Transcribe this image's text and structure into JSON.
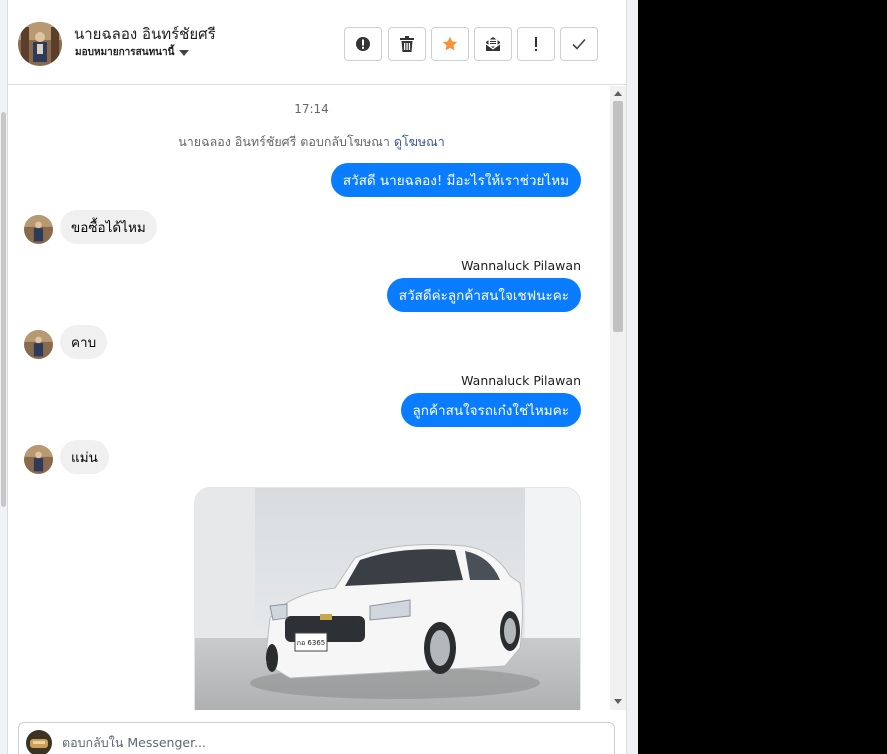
{
  "header": {
    "contact_name": "นายฉลอง อินทร์ชัยศรี",
    "assign_label": "มอบหมายการสนทนานี้",
    "buttons": [
      {
        "name": "report-button",
        "icon": "exclamation-circle-icon"
      },
      {
        "name": "delete-button",
        "icon": "trash-icon"
      },
      {
        "name": "star-button",
        "icon": "star-icon",
        "color": "#f7923b"
      },
      {
        "name": "mark-unread-button",
        "icon": "envelope-open-icon"
      },
      {
        "name": "spam-button",
        "icon": "exclamation-icon"
      },
      {
        "name": "done-button",
        "icon": "checkmark-icon"
      }
    ]
  },
  "conversation": {
    "timestamp": "17:14",
    "system_text": "นายฉลอง อินทร์ชัยศรี ตอบกลับโฆษณา",
    "system_link": "ดูโฆษณา",
    "messages": [
      {
        "dir": "out",
        "text": "สวัสดี นายฉลอง! มีอะไรให้เราช่วยไหม"
      },
      {
        "dir": "in",
        "text": "ขอซื้อได้ไหม"
      },
      {
        "dir": "out",
        "sender": "Wannaluck Pilawan",
        "text": "สวัสดีค่ะลูกค้าสนใจเชฟนะคะ"
      },
      {
        "dir": "in",
        "text": "คาบ"
      },
      {
        "dir": "out",
        "sender": "Wannaluck Pilawan",
        "text": "ลูกค้าสนใจรถเก๋งใช่ไหมคะ"
      },
      {
        "dir": "in",
        "text": "แม่น"
      }
    ],
    "attachment": {
      "type": "image",
      "subject": "white-sedan-photo",
      "plate": "กอ 6365"
    }
  },
  "composer": {
    "placeholder": "ตอบกลับใน Messenger..."
  },
  "colors": {
    "accent": "#0a7cff",
    "incoming_bubble": "#f0f0f0",
    "star": "#f7923b",
    "link": "#385898"
  }
}
